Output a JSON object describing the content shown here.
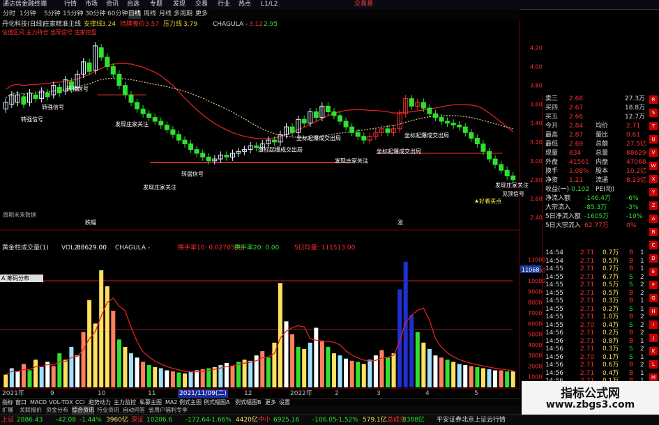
{
  "app": {
    "title": "通达信金融终端",
    "brand": "交易易"
  },
  "menu": [
    "行情",
    "市场",
    "资讯",
    "自选",
    "专题",
    "发现",
    "交易",
    "行业",
    "热点",
    "L1/L2"
  ],
  "toolbar": [
    "分时",
    "1分钟",
    "5分钟",
    "15分钟",
    "30分钟",
    "60分钟",
    "日线",
    "周线",
    "月线",
    "多周期",
    "更多"
  ],
  "stock": {
    "name": "丹化科技(日线)",
    "indicator": "庄家精准主线",
    "support_label": "支撑线",
    "support_value": "3.24",
    "cost_label": "持牌差价",
    "cost_value": "3.57",
    "pressure_label": "压力线",
    "pressure_value": "3.79",
    "chagula_label": "CHAGULA -",
    "chagula_v1": "3.12",
    "chagula_v2": "2.95"
  },
  "indicator_legend": "估值区间 主力持仓 出现信号 庄家控盘",
  "annotations": [
    "转强信号",
    "转强信号",
    "转强信号",
    "发现庄家关注",
    "发现庄家关注",
    "发现庄家关注",
    "转弱信号",
    "坐标起爆成交出局",
    "坐标起爆成交出局",
    "坐标起爆成交出局",
    "坐标起爆成交出局",
    "★好看买点",
    "发现庄家关注",
    "见顶信号"
  ],
  "chart_notes": {
    "future": "周期未来数据",
    "vol_marker_1": "跌幅",
    "vol_marker_2": "涨"
  },
  "price_axis": [
    "4.20",
    "4.00",
    "3.80",
    "3.60",
    "3.40",
    "3.20",
    "3.00",
    "2.80",
    "2.60",
    "2.40"
  ],
  "volume": {
    "indicator": "黄金柱成交量(1)",
    "vol2_label": "VOL2:",
    "vol2_value": "88629.00",
    "chagula": "CHAGULA -",
    "turnover10": "换手率10: 0.0270583",
    "turnover20": "换手率20: 0.00",
    "mavol": "5日均量: 111513.00",
    "box_label": "A 筹码分布"
  },
  "vol_axis": [
    "12000",
    "11000",
    "10000",
    "9000",
    "8000",
    "7000",
    "6000",
    "5000",
    "4000",
    "3000",
    "2000",
    "1000"
  ],
  "vol_axis_current": "11068",
  "xaxis": [
    "2021年",
    "9",
    "10",
    "11",
    "2021/11/09(二)",
    "12",
    "2022年",
    "2",
    "3",
    "4",
    "5"
  ],
  "bottom_tabs": [
    "指标",
    "窗口",
    "MACD",
    "VOL-TDX",
    "CCI",
    "趋势动力",
    "主力监控",
    "私募主图",
    "MA2",
    "例式主图",
    "例式幅图A",
    "例式幅图B",
    "更多",
    "设置"
  ],
  "bottom_tabs2": [
    "扩展",
    "关联报价",
    "资金分布",
    "综合资讯",
    "行业资讯",
    "自动问答",
    "省用户福利专享"
  ],
  "quote": [
    {
      "label": "卖三",
      "value": "2.68",
      "extra": "27.3万"
    },
    {
      "label": "买四",
      "value": "2.67",
      "extra": "18.8万"
    },
    {
      "label": "买五",
      "value": "2.66",
      "extra": "12.7万"
    },
    {
      "label": "今开",
      "value": "2.84",
      "l2": "均价",
      "v2": "2.71"
    },
    {
      "label": "最高",
      "value": "2.87",
      "l2": "量比",
      "v2": "0.61"
    },
    {
      "label": "最低",
      "value": "2.69",
      "l2": "总额",
      "v2": "27.5亿"
    },
    {
      "label": "现量",
      "value": "834",
      "l2": "总量",
      "v2": "88629"
    },
    {
      "label": "外盘",
      "value": "41561",
      "l2": "内盘",
      "v2": "47068"
    },
    {
      "label": "换手",
      "value": "1.08%",
      "l2": "股本",
      "v2": "10.2亿"
    },
    {
      "label": "净资",
      "value": "1.21",
      "l2": "流通",
      "v2": "8.23亿"
    },
    {
      "label": "收益(一)",
      "value": "-0.102",
      "l2": "PE(动)",
      "v2": ""
    },
    {
      "label": "净流入额",
      "value": "-146.4万",
      "v2": "-6%"
    },
    {
      "label": "大宗流入",
      "value": "-85.3万",
      "v2": "-3%"
    },
    {
      "label": "5日净流入额",
      "value": "-1605万",
      "v2": "-10%"
    },
    {
      "label": "5日大宗流入",
      "value": "62.77万",
      "v2": "0%"
    }
  ],
  "ticks": [
    {
      "t": "14:54",
      "p": "2.71",
      "v": "0.7万",
      "s": "B",
      "n": "1"
    },
    {
      "t": "14:54",
      "p": "2.71",
      "v": "0.5万",
      "s": "B",
      "n": "1"
    },
    {
      "t": "14:55",
      "p": "2.71",
      "v": "0.7万",
      "s": "B",
      "n": "1"
    },
    {
      "t": "14:55",
      "p": "2.71",
      "v": "6.7万",
      "s": "S",
      "n": "2"
    },
    {
      "t": "14:55",
      "p": "2.71",
      "v": "0.5万",
      "s": "S",
      "n": "2"
    },
    {
      "t": "14:55",
      "p": "2.71",
      "v": "0.5万",
      "s": "B",
      "n": "2"
    },
    {
      "t": "14:55",
      "p": "2.71",
      "v": "0.3万",
      "s": "B",
      "n": "1"
    },
    {
      "t": "14:55",
      "p": "2.71",
      "v": "0.2万",
      "s": "S",
      "n": "1"
    },
    {
      "t": "14:55",
      "p": "2.71",
      "v": "1.0万",
      "s": "B",
      "n": "2"
    },
    {
      "t": "14:55",
      "p": "2.70",
      "v": "0.4万",
      "s": "S",
      "n": "2"
    },
    {
      "t": "14:56",
      "p": "2.71",
      "v": "0.2万",
      "s": "B",
      "n": "2"
    },
    {
      "t": "14:56",
      "p": "2.71",
      "v": "0.8万",
      "s": "B",
      "n": "1"
    },
    {
      "t": "14:56",
      "p": "2.71",
      "v": "0.3万",
      "s": "S",
      "n": "2"
    },
    {
      "t": "14:56",
      "p": "2.70",
      "v": "0.1万",
      "s": "S",
      "n": "1"
    },
    {
      "t": "14:56",
      "p": "2.71",
      "v": "0.6万",
      "s": "B",
      "n": "2"
    },
    {
      "t": "14:56",
      "p": "2.71",
      "v": "0.4万",
      "s": "B",
      "n": "1"
    },
    {
      "t": "14:56",
      "p": "2.71",
      "v": "0.1万",
      "s": "B",
      "n": "1"
    }
  ],
  "status": [
    {
      "name": "上证",
      "v": "2886.43",
      "c": "-42.08",
      "p": "-1.44%",
      "a": "3960亿"
    },
    {
      "name": "深证",
      "v": "10206.6",
      "c": "-172.64",
      "p": "-1.66%",
      "a": "4420亿"
    },
    {
      "name": "中小",
      "v": "6925.16",
      "c": "-106.05",
      "p": "-1.52%",
      "a": "579.1亿"
    },
    {
      "name": "总成交",
      "v": "8388亿",
      "c": "",
      "p": "",
      "a": ""
    }
  ],
  "status_right": "平安证券北京上证云行情",
  "side_buttons": [
    "R",
    "S",
    "T",
    "U",
    "V",
    "W",
    "X",
    "Y",
    "Z",
    "A",
    "B",
    "C",
    "D",
    "E",
    "F",
    "G",
    "H",
    "I",
    "J",
    "K",
    "L",
    "M",
    "N"
  ],
  "watermark": {
    "title": "指标公式网",
    "url": "www.zbgs3.com"
  },
  "colors": {
    "up": "#ff3030",
    "down": "#30e030",
    "ma_red": "#e02020",
    "ma_yellow": "#e0d020",
    "ma_dotted": "#d0c080",
    "accent_blue": "#2040c0"
  },
  "chart_data": {
    "type": "candlestick",
    "price_ylim": [
      2.4,
      4.3
    ],
    "volume_ylim": [
      0,
      12500
    ],
    "candles": [
      [
        3.55,
        3.62
      ],
      [
        3.6,
        3.7
      ],
      [
        3.62,
        3.7
      ],
      [
        3.68,
        3.6
      ],
      [
        3.62,
        3.72
      ],
      [
        3.7,
        3.66
      ],
      [
        3.66,
        3.74
      ],
      [
        3.72,
        3.68
      ],
      [
        3.7,
        3.8
      ],
      [
        3.78,
        3.72
      ],
      [
        3.74,
        3.86
      ],
      [
        3.84,
        3.76
      ],
      [
        3.78,
        3.92
      ],
      [
        3.92,
        4.05
      ],
      [
        4.04,
        3.95
      ],
      [
        3.96,
        4.22
      ],
      [
        4.2,
        4.1
      ],
      [
        4.1,
        4.0
      ],
      [
        4.0,
        3.92
      ],
      [
        3.92,
        3.8
      ],
      [
        3.8,
        3.7
      ],
      [
        3.7,
        3.62
      ],
      [
        3.62,
        3.55
      ],
      [
        3.55,
        3.5
      ],
      [
        3.5,
        3.46
      ],
      [
        3.46,
        3.42
      ],
      [
        3.42,
        3.38
      ],
      [
        3.38,
        3.33
      ],
      [
        3.33,
        3.28
      ],
      [
        3.28,
        3.22
      ],
      [
        3.22,
        3.18
      ],
      [
        3.18,
        3.12
      ],
      [
        3.12,
        3.08
      ],
      [
        3.08,
        3.04
      ],
      [
        3.04,
        3.0
      ],
      [
        3.0,
        3.02
      ],
      [
        3.02,
        3.06
      ],
      [
        3.06,
        3.04
      ],
      [
        3.04,
        3.08
      ],
      [
        3.08,
        3.1
      ],
      [
        3.1,
        3.12
      ],
      [
        3.12,
        3.16
      ],
      [
        3.16,
        3.14
      ],
      [
        3.14,
        3.18
      ],
      [
        3.18,
        3.22
      ],
      [
        3.22,
        3.2
      ],
      [
        3.2,
        3.28
      ],
      [
        3.28,
        3.36
      ],
      [
        3.36,
        3.3
      ],
      [
        3.3,
        3.44
      ],
      [
        3.44,
        3.4
      ],
      [
        3.4,
        3.52
      ],
      [
        3.52,
        3.46
      ],
      [
        3.46,
        3.58
      ],
      [
        3.58,
        3.52
      ],
      [
        3.52,
        3.48
      ],
      [
        3.48,
        3.42
      ],
      [
        3.42,
        3.36
      ],
      [
        3.36,
        3.3
      ],
      [
        3.3,
        3.26
      ],
      [
        3.26,
        3.22
      ],
      [
        3.22,
        3.26
      ],
      [
        3.26,
        3.3
      ],
      [
        3.3,
        3.34
      ],
      [
        3.34,
        3.3
      ],
      [
        3.3,
        3.34
      ],
      [
        3.34,
        3.5
      ],
      [
        3.5,
        3.66
      ],
      [
        3.66,
        3.58
      ],
      [
        3.58,
        3.62
      ],
      [
        3.62,
        3.56
      ],
      [
        3.56,
        3.5
      ],
      [
        3.5,
        3.46
      ],
      [
        3.46,
        3.42
      ],
      [
        3.42,
        3.4
      ],
      [
        3.4,
        3.38
      ],
      [
        3.38,
        3.36
      ],
      [
        3.36,
        3.3
      ],
      [
        3.3,
        3.24
      ],
      [
        3.24,
        3.18
      ],
      [
        3.18,
        3.1
      ],
      [
        3.1,
        3.02
      ],
      [
        3.02,
        2.96
      ],
      [
        2.96,
        2.9
      ],
      [
        2.9,
        2.84
      ],
      [
        2.84,
        2.8
      ]
    ],
    "volumes": [
      1200,
      1800,
      1500,
      2200,
      1600,
      2600,
      1900,
      2400,
      2000,
      3200,
      2600,
      3800,
      3000,
      5200,
      8200,
      6000,
      11000,
      9500,
      7200,
      4500,
      3800,
      3200,
      2800,
      2400,
      2100,
      1900,
      1800,
      1600,
      1500,
      1400,
      1300,
      1500,
      1600,
      1700,
      1800,
      1900,
      2100,
      2300,
      2000,
      2400,
      2600,
      2500,
      3000,
      3400,
      2800,
      4200,
      9800,
      6200,
      5000,
      3800,
      3600,
      4200,
      5600,
      4400,
      3800,
      3200,
      3000,
      2700,
      2500,
      2400,
      2200,
      2600,
      3000,
      3500,
      2800,
      3200,
      9200,
      11800,
      6800,
      5200,
      4200,
      3600,
      3000,
      2800,
      2600,
      2400,
      2200,
      2100,
      2000,
      1900,
      1800,
      1700,
      1600,
      1600,
      1500,
      1500
    ],
    "xlabels": [
      "2021年",
      "9",
      "10",
      "11",
      "2021/11/09(二)",
      "12",
      "2022年",
      "2",
      "3",
      "4",
      "5"
    ]
  }
}
